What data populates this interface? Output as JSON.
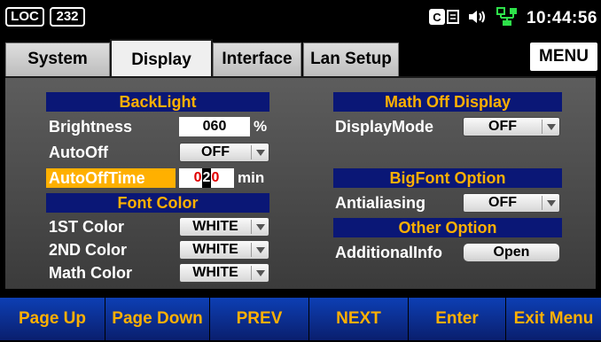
{
  "status": {
    "loc": "LOC",
    "remote_count": "232",
    "clock": "10:44:56",
    "icons": [
      "calendar-icon",
      "speaker-icon",
      "network-icon"
    ]
  },
  "tabs": [
    {
      "label": "System",
      "active": false
    },
    {
      "label": "Display",
      "active": true
    },
    {
      "label": "Interface",
      "active": false
    },
    {
      "label": "Lan Setup",
      "active": false
    }
  ],
  "menu_label": "MENU",
  "left": {
    "backlight_header": "BackLight",
    "brightness_label": "Brightness",
    "brightness_value": "060",
    "brightness_unit": "%",
    "autooff_label": "AutoOff",
    "autooff_value": "OFF",
    "autoofftime_label": "AutoOffTime",
    "autoofftime_digits": [
      "0",
      "2",
      "0"
    ],
    "autoofftime_unit": "min",
    "fontcolor_header": "Font Color",
    "color1_label": "1ST Color",
    "color1_value": "WHITE",
    "color2_label": "2ND Color",
    "color2_value": "WHITE",
    "mathcolor_label": "Math Color",
    "mathcolor_value": "WHITE"
  },
  "right": {
    "mathoff_header": "Math Off Display",
    "displaymode_label": "DisplayMode",
    "displaymode_value": "OFF",
    "bigfont_header": "BigFont Option",
    "antialiasing_label": "Antialiasing",
    "antialiasing_value": "OFF",
    "other_header": "Other Option",
    "additionalinfo_label": "AdditionalInfo",
    "additionalinfo_button": "Open"
  },
  "softkeys": [
    "Page Up",
    "Page Down",
    "PREV",
    "NEXT",
    "Enter",
    "Exit Menu"
  ],
  "colors": {
    "header_bg": "#0a1776",
    "header_text": "#ffb000",
    "highlight": "#ffb000",
    "softkey_text": "#ffb000",
    "softkey_bg": "#0d3fb4"
  }
}
